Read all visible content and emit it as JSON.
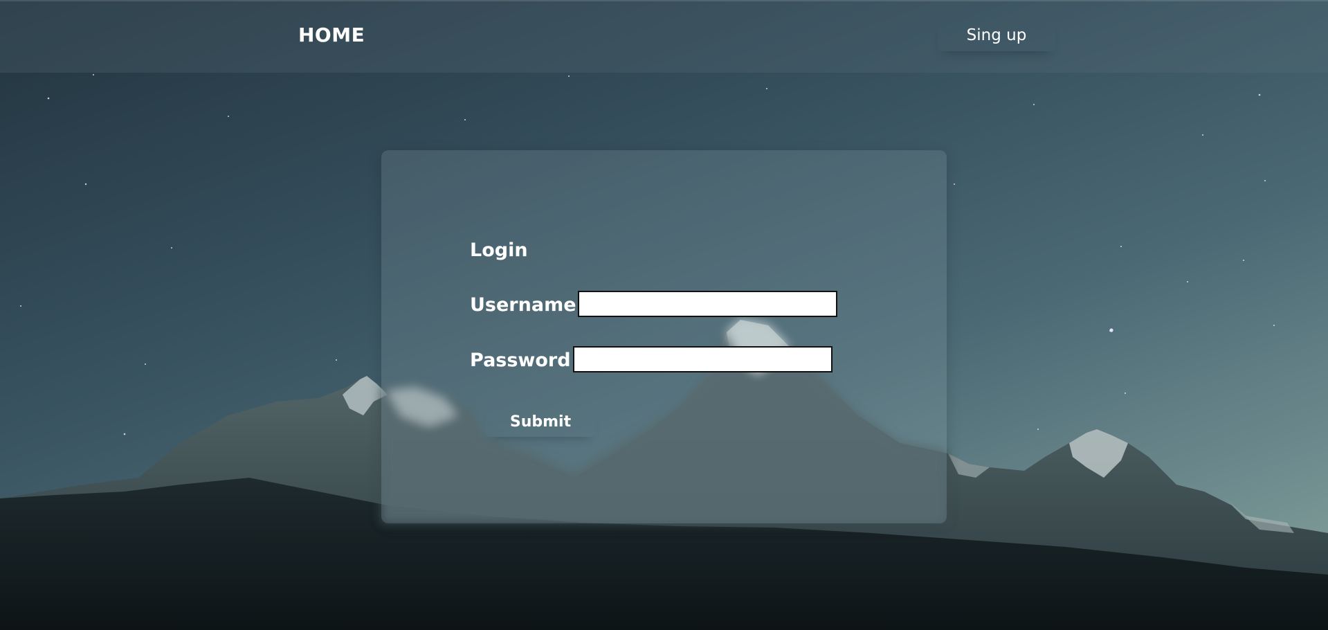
{
  "navbar": {
    "home_label": "HOME",
    "signup_label": "Sing up"
  },
  "login": {
    "title": "Login",
    "username_label": "Username",
    "username_value": "",
    "password_label": "Password",
    "password_value": "",
    "submit_label": "Submit"
  },
  "colors": {
    "text": "#ffffff",
    "input_bg": "#ffffff",
    "input_border": "#111111",
    "sky_dark": "#22343f",
    "sky_light": "#8aa39d"
  },
  "background": {
    "icon": "mountain-night-sky-image"
  }
}
